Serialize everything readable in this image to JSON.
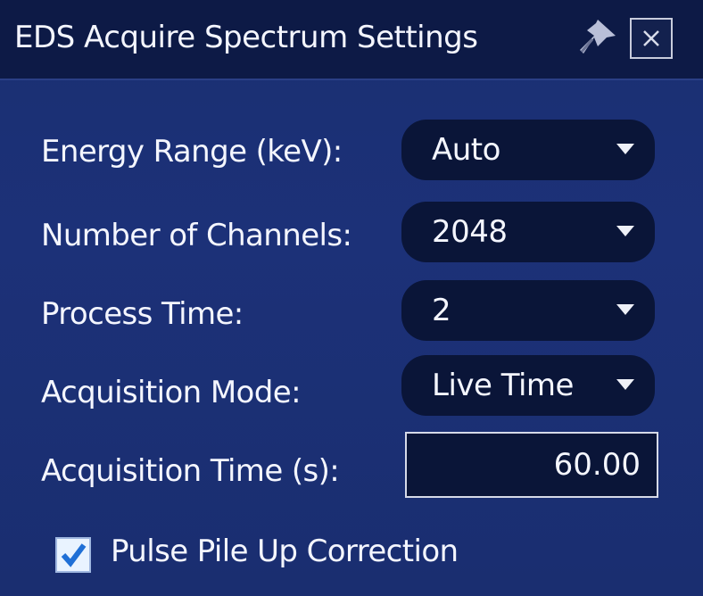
{
  "dialog": {
    "title": "EDS Acquire Spectrum Settings",
    "pin_icon": "pin-icon",
    "close_icon": "close-icon"
  },
  "settings": {
    "energy_range": {
      "label": "Energy Range (keV):",
      "value": "Auto"
    },
    "channels": {
      "label": "Number of Channels:",
      "value": "2048"
    },
    "process_time": {
      "label": "Process Time:",
      "value": "2"
    },
    "acquisition_mode": {
      "label": "Acquisition Mode:",
      "value": "Live Time"
    },
    "acquisition_time": {
      "label": "Acquisition Time (s):",
      "value": "60.00"
    }
  },
  "pulse_pile_up": {
    "label": "Pulse Pile Up Correction",
    "checked": true
  },
  "colors": {
    "panel": "#1c3178",
    "titlebar": "#0d1a46",
    "control": "#0a1538",
    "text": "#f4f6ff"
  }
}
